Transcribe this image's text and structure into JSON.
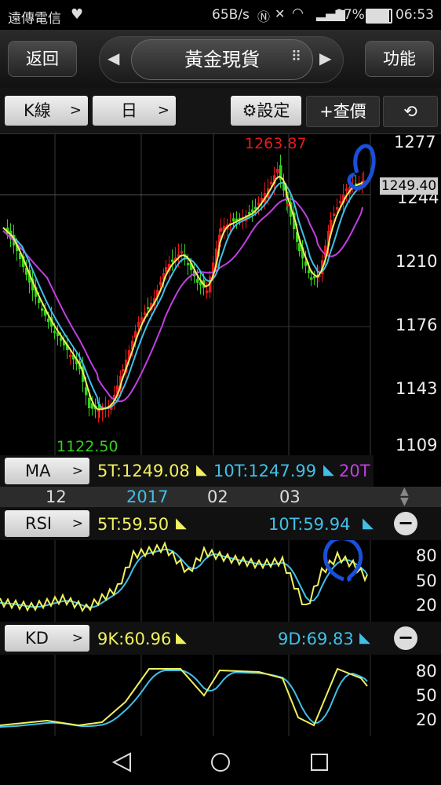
{
  "status": {
    "carrier": "遠傳電信",
    "net_speed": "65B/s",
    "battery": "97%",
    "time": "06:53"
  },
  "header": {
    "back": "返回",
    "title": "黃金現貨",
    "function": "功能"
  },
  "toolbar": {
    "chart_type": "K線",
    "period": "日",
    "settings": "設定",
    "query": "+查價"
  },
  "main_chart": {
    "y_ticks": [
      "1277",
      "1244",
      "1210",
      "1176",
      "1143",
      "1109"
    ],
    "high_label": "1263.87",
    "low_label": "1122.50",
    "price_tag": "1249.40",
    "x_labels": [
      "12",
      "2017",
      "02",
      "03"
    ]
  },
  "ma": {
    "label": "MA",
    "ma5": "5T:1249.08",
    "ma10": "10T:1247.99",
    "ma20": "20T"
  },
  "rsi": {
    "label": "RSI",
    "rsi5": "5T:59.50",
    "rsi10": "10T:59.94",
    "y_ticks": [
      "80",
      "50",
      "20"
    ]
  },
  "kd": {
    "label": "KD",
    "k": "9K:60.96",
    "d": "9D:69.83",
    "y_ticks": [
      "80",
      "50",
      "20"
    ]
  },
  "colors": {
    "up": "#e8191b",
    "down": "#34d11b",
    "ma5": "#f0f060",
    "ma10": "#40c0e8",
    "ma20": "#c040e0",
    "rsi5": "#f0f060",
    "rsi10": "#40c0e8"
  }
}
